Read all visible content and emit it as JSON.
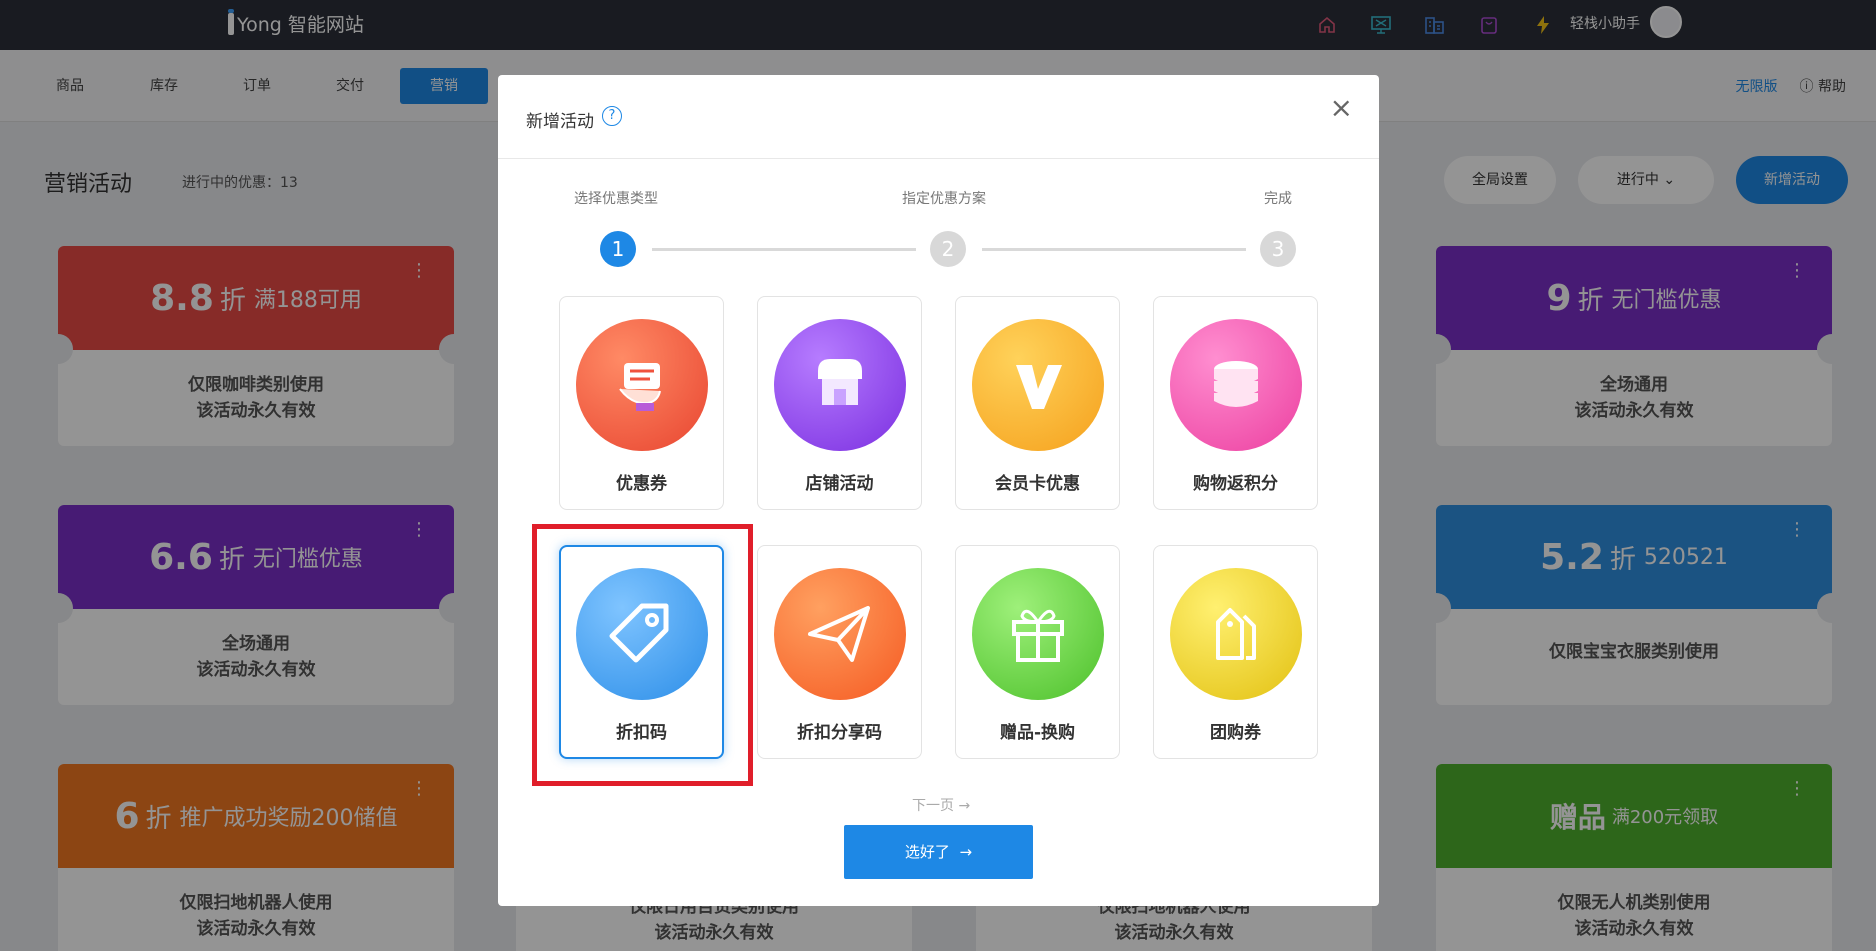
{
  "topbar": {
    "logo": "Yong 智能网站",
    "user_name": "轻栈小助手",
    "icons": [
      "home-icon",
      "monitor-icon",
      "building-icon",
      "bag-icon",
      "bolt-icon"
    ]
  },
  "subnav": {
    "tabs": [
      "商品",
      "库存",
      "订单",
      "交付",
      "营销"
    ],
    "active_tab": "营销",
    "edition_link": "无限版",
    "help_label": "帮助"
  },
  "page": {
    "title": "营销活动",
    "active_count_label": "进行中的优惠：13",
    "global_settings": "全局设置",
    "status_filter": "进行中",
    "new_activity": "新增活动"
  },
  "cards": [
    {
      "big": "8.8",
      "unit": "折",
      "desc": "满188可用",
      "line1": "仅限咖啡类别使用",
      "line2": "该活动永久有效",
      "color": "#e94a45"
    },
    {
      "big": "6.6",
      "unit": "折",
      "desc": "无门槛优惠",
      "line1": "全场通用",
      "line2": "该活动永久有效",
      "color": "#7a2fc8"
    },
    {
      "big": "6",
      "unit": "折",
      "desc": "推广成功奖励200储值",
      "line1": "仅限扫地机器人使用",
      "line2": "该活动永久有效",
      "color": "#f27722"
    },
    {
      "big": "9",
      "unit": "折",
      "desc": "无门槛优惠",
      "line1": "全场通用",
      "line2": "该活动永久有效",
      "color": "#7a2fc8"
    },
    {
      "big": "5.2",
      "unit": "折",
      "desc": "520521",
      "line1": "仅限宝宝衣服类别使用",
      "line2": "",
      "color": "#2f8fe0"
    },
    {
      "big": "赠品",
      "unit": "",
      "desc": "满200元领取",
      "line1": "仅限无人机类别使用",
      "line2": "该活动永久有效",
      "color": "#4fb02e"
    }
  ],
  "middle_cards": [
    {
      "line1": "仅限日用百货类别使用",
      "line2": "该活动永久有效"
    },
    {
      "line1": "仅限扫地机器人使用",
      "line2": "该活动永久有效"
    }
  ],
  "modal": {
    "title": "新增活动",
    "steps": [
      "选择优惠类型",
      "指定优惠方案",
      "完成"
    ],
    "step_numbers": [
      "1",
      "2",
      "3"
    ],
    "tiles": [
      {
        "label": "优惠券",
        "icon": "coupon-hand-icon",
        "color": "#f0523d"
      },
      {
        "label": "店铺活动",
        "icon": "store-icon",
        "color": "#8b3fe0"
      },
      {
        "label": "会员卡优惠",
        "icon": "vip-icon",
        "color": "#f5a81c"
      },
      {
        "label": "购物返积分",
        "icon": "coins-icon",
        "color": "#f04aa8"
      },
      {
        "label": "折扣码",
        "icon": "tag-icon",
        "color": "#3a9cf0"
      },
      {
        "label": "折扣分享码",
        "icon": "paper-plane-icon",
        "color": "#f5652a"
      },
      {
        "label": "赠品-换购",
        "icon": "gift-icon",
        "color": "#5cc83a"
      },
      {
        "label": "团购券",
        "icon": "group-tags-icon",
        "color": "#e8c41c"
      }
    ],
    "selected_tile": "折扣码",
    "next_page": "下一页",
    "confirm": "选好了"
  }
}
